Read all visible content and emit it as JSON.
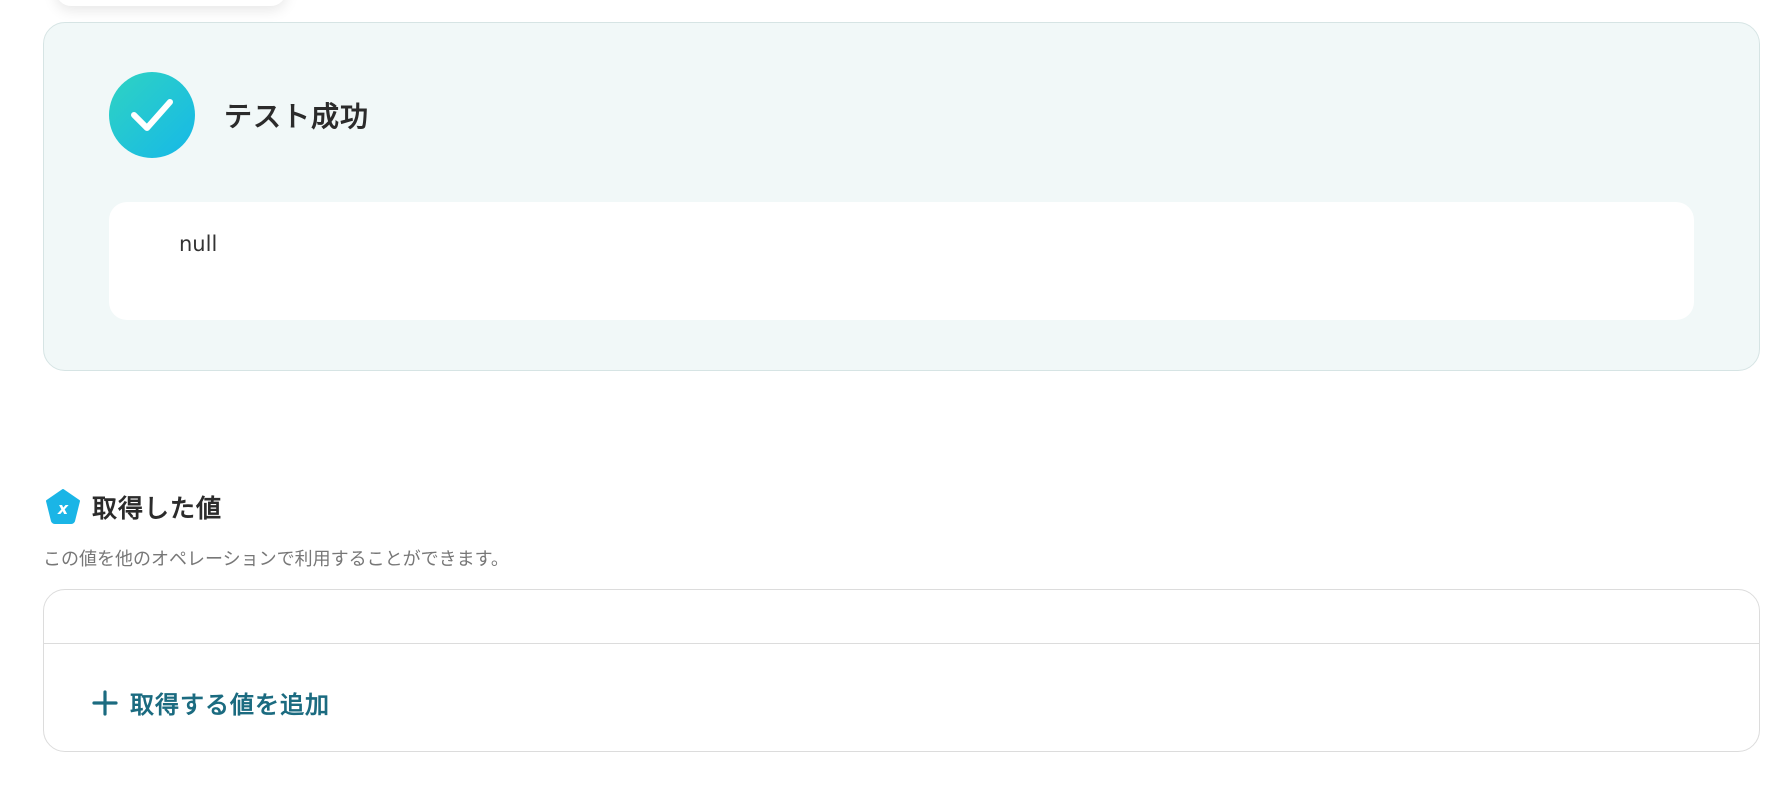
{
  "test_result": {
    "status_title": "テスト成功",
    "output_value": "null"
  },
  "retrieved_values": {
    "title": "取得した値",
    "description": "この値を他のオペレーションで利用することができます。",
    "add_button_label": "取得する値を追加",
    "icon_glyph": "x"
  },
  "icons": {
    "success": "check-icon",
    "section": "variable-pentagon-icon",
    "add": "plus-icon"
  },
  "colors": {
    "success_gradient_start": "#2fd3c2",
    "success_gradient_end": "#16b8e8",
    "panel_background": "#f1f8f8",
    "section_icon": "#1ab5e6",
    "add_button": "#1b6b80"
  }
}
